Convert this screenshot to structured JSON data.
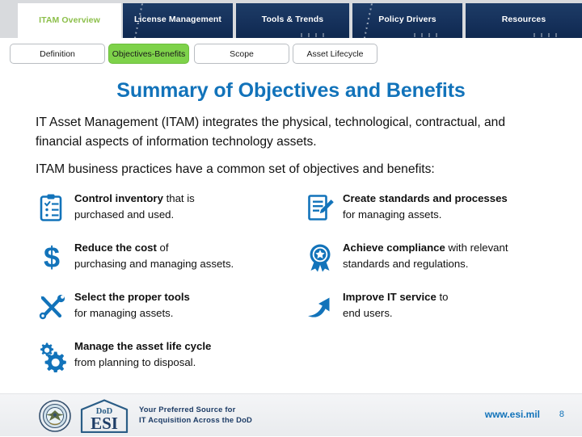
{
  "colors": {
    "tab_active_text": "#8cbf4a",
    "tab_inactive_bg": "#1d3c66",
    "subtab_active_bg": "#7ed24a",
    "title_blue": "#1273ba",
    "icon_blue": "#1273ba",
    "footer_navy": "#1d3c66"
  },
  "top_tabs": [
    {
      "label": "ITAM Overview",
      "active": true
    },
    {
      "label": "License Management",
      "active": false
    },
    {
      "label": "Tools & Trends",
      "active": false
    },
    {
      "label": "Policy Drivers",
      "active": false
    },
    {
      "label": "Resources",
      "active": false
    }
  ],
  "sub_tabs": [
    {
      "label": "Definition",
      "active": false
    },
    {
      "label": "Objectives-Benefits",
      "active": true
    },
    {
      "label": "Scope",
      "active": false
    },
    {
      "label": "Asset Lifecycle",
      "active": false
    }
  ],
  "title": "Summary of Objectives and Benefits",
  "intro": {
    "p1": "IT Asset Management (ITAM) integrates the physical, technological, contractual, and financial aspects of information technology assets.",
    "p2": "ITAM business practices have a common set of objectives and benefits:"
  },
  "benefits_left": [
    {
      "icon": "clipboard-checklist-icon",
      "bold": "Control inventory",
      "rest": " that is",
      "line2": "purchased and used."
    },
    {
      "icon": "dollar-sign-icon",
      "bold": "Reduce the cost",
      "rest": " of",
      "line2": "purchasing and managing assets."
    },
    {
      "icon": "tools-icon",
      "bold": "Select the proper tools",
      "rest": "",
      "line2": "for managing assets."
    },
    {
      "icon": "gears-icon",
      "bold": "Manage the asset life cycle",
      "rest": "",
      "line2": "from planning to disposal."
    }
  ],
  "benefits_right": [
    {
      "icon": "document-pencil-icon",
      "bold": "Create standards and processes",
      "rest": "",
      "line2": "for managing assets."
    },
    {
      "icon": "award-ribbon-icon",
      "bold": "Achieve compliance",
      "rest": " with relevant",
      "line2": "standards and regulations."
    },
    {
      "icon": "curved-arrow-up-icon",
      "bold": "Improve IT service",
      "rest": " to",
      "line2": "end users."
    }
  ],
  "footer": {
    "logo_top": "DoD",
    "logo_bottom": "ESI",
    "tagline_line1": "Your Preferred Source for",
    "tagline_line2": "IT Acquisition Across the DoD",
    "website": "www.esi.mil",
    "page_number": "8"
  }
}
